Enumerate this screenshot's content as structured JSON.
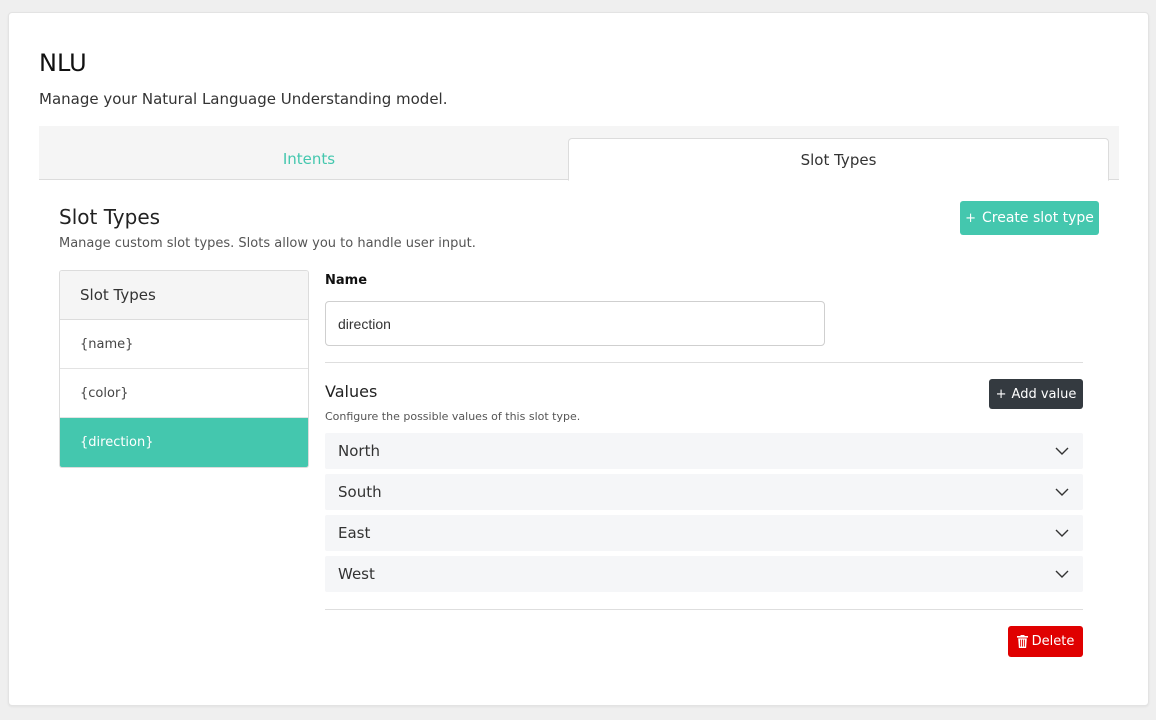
{
  "page": {
    "title": "NLU",
    "subtitle": "Manage your Natural Language Understanding model."
  },
  "tabs": [
    {
      "label": "Intents",
      "active": false
    },
    {
      "label": "Slot Types",
      "active": true
    }
  ],
  "section": {
    "title": "Slot Types",
    "subtitle": "Manage custom slot types. Slots allow you to handle user input.",
    "create_button": "Create slot type",
    "create_icon": "plus-icon"
  },
  "slot_list": {
    "header": "Slot Types",
    "items": [
      {
        "label": "{name}",
        "active": false
      },
      {
        "label": "{color}",
        "active": false
      },
      {
        "label": "{direction}",
        "active": true
      }
    ]
  },
  "editor": {
    "name_label": "Name",
    "name_value": "direction",
    "values_title": "Values",
    "values_subtitle": "Configure the possible values of this slot type.",
    "add_value_button": "Add value",
    "values": [
      "North",
      "South",
      "East",
      "West"
    ],
    "delete_button": "Delete",
    "delete_icon": "trash-icon"
  },
  "colors": {
    "accent": "#44c7ae",
    "dark_button": "#343a40",
    "danger": "#e00000"
  }
}
